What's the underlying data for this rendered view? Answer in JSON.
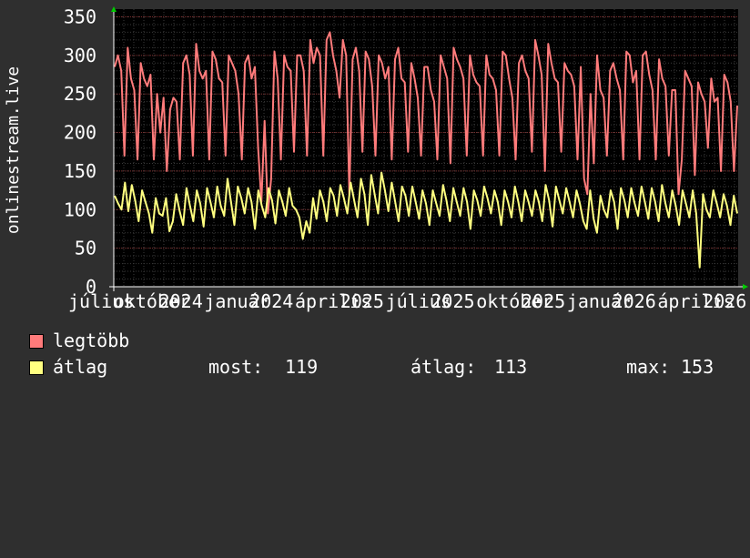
{
  "chart_data": {
    "type": "line",
    "ylabel": "onlinestream.live",
    "ylim": [
      0,
      360
    ],
    "yticks": [
      0,
      50,
      100,
      150,
      200,
      250,
      300,
      350
    ],
    "x_tick_labels": [
      "július",
      "október",
      "2024",
      "január",
      "2024",
      "április",
      "2025",
      "július",
      "2025",
      "október",
      "2025",
      "január",
      "2026",
      "április",
      "2026"
    ],
    "grid": true,
    "legend_placement": "bottom-left",
    "series": [
      {
        "name": "legtöbb",
        "color": "#ff7b7b",
        "sample_interval_days": 3,
        "values": [
          285,
          300,
          280,
          170,
          310,
          270,
          255,
          165,
          290,
          270,
          260,
          275,
          165,
          250,
          200,
          245,
          150,
          230,
          245,
          240,
          165,
          290,
          300,
          275,
          170,
          315,
          280,
          270,
          280,
          165,
          305,
          295,
          270,
          265,
          170,
          300,
          290,
          280,
          250,
          165,
          290,
          300,
          270,
          285,
          180,
          110,
          215,
          95,
          140,
          305,
          270,
          165,
          300,
          285,
          280,
          175,
          300,
          300,
          280,
          170,
          320,
          290,
          310,
          300,
          170,
          320,
          330,
          300,
          280,
          245,
          320,
          300,
          120,
          295,
          310,
          280,
          175,
          305,
          295,
          260,
          170,
          300,
          290,
          270,
          285,
          165,
          295,
          310,
          270,
          265,
          175,
          290,
          270,
          245,
          170,
          285,
          285,
          255,
          240,
          165,
          300,
          285,
          270,
          160,
          310,
          295,
          285,
          270,
          170,
          300,
          275,
          265,
          260,
          170,
          300,
          275,
          270,
          255,
          170,
          305,
          300,
          270,
          245,
          165,
          290,
          300,
          280,
          270,
          175,
          320,
          300,
          275,
          150,
          315,
          290,
          270,
          265,
          175,
          290,
          280,
          275,
          260,
          165,
          285,
          140,
          120,
          250,
          160,
          300,
          255,
          245,
          170,
          280,
          290,
          270,
          255,
          165,
          305,
          300,
          265,
          280,
          165,
          300,
          305,
          275,
          255,
          165,
          295,
          270,
          260,
          170,
          255,
          255,
          120,
          165,
          280,
          270,
          260,
          145,
          265,
          250,
          240,
          180,
          270,
          240,
          245,
          150,
          275,
          265,
          240,
          150,
          235
        ]
      },
      {
        "name": "átlag",
        "color": "#ffff80",
        "sample_interval_days": 3,
        "values": [
          118,
          108,
          100,
          135,
          98,
          132,
          112,
          85,
          125,
          110,
          95,
          70,
          115,
          95,
          92,
          115,
          72,
          85,
          120,
          98,
          80,
          128,
          105,
          85,
          125,
          108,
          78,
          128,
          110,
          90,
          130,
          105,
          92,
          140,
          110,
          80,
          130,
          115,
          95,
          128,
          110,
          75,
          125,
          105,
          90,
          128,
          112,
          82,
          125,
          110,
          92,
          128,
          105,
          100,
          90,
          62,
          85,
          70,
          115,
          88,
          125,
          110,
          85,
          128,
          118,
          92,
          132,
          115,
          95,
          135,
          112,
          90,
          140,
          120,
          80,
          145,
          120,
          95,
          148,
          125,
          98,
          135,
          110,
          85,
          130,
          118,
          92,
          130,
          110,
          88,
          125,
          108,
          80,
          125,
          108,
          92,
          132,
          112,
          85,
          128,
          110,
          92,
          128,
          110,
          75,
          125,
          112,
          92,
          130,
          115,
          95,
          125,
          110,
          80,
          125,
          110,
          90,
          130,
          110,
          85,
          125,
          110,
          92,
          125,
          110,
          85,
          132,
          112,
          78,
          130,
          112,
          95,
          128,
          110,
          90,
          125,
          108,
          85,
          75,
          125,
          88,
          70,
          118,
          100,
          90,
          125,
          110,
          75,
          128,
          112,
          90,
          128,
          108,
          92,
          130,
          110,
          88,
          128,
          110,
          85,
          132,
          108,
          90,
          125,
          105,
          80,
          125,
          108,
          90,
          125,
          95,
          25,
          120,
          100,
          90,
          125,
          108,
          90,
          120,
          105,
          80,
          118,
          95
        ]
      }
    ]
  },
  "legend": {
    "items": [
      {
        "label": "legtöbb",
        "color": "#ff7b7b"
      },
      {
        "label": "átlag",
        "color": "#ffff80"
      }
    ],
    "stats": {
      "now_label": "most:",
      "now_value": "119",
      "avg_label": "átlag:",
      "avg_value": "113",
      "max_label": "max:",
      "max_value": "153"
    }
  }
}
